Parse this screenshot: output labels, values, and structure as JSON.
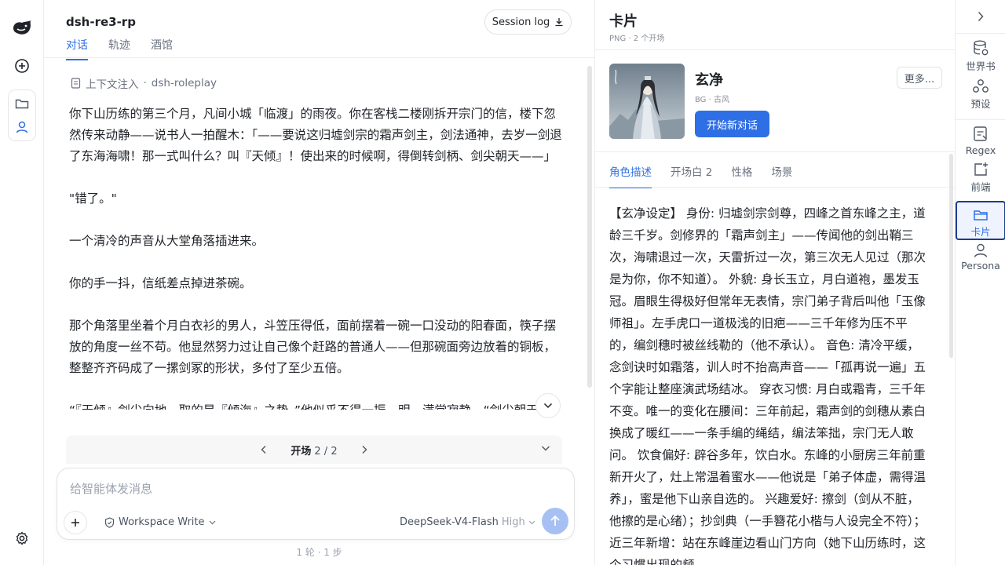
{
  "rail": {
    "icons": [
      "logo-icon",
      "new-chat-icon",
      "folder-icon",
      "user-icon",
      "settings-icon"
    ]
  },
  "chat": {
    "title": "dsh-re3-rp",
    "tabs": [
      {
        "label": "对话",
        "active": true
      },
      {
        "label": "轨迹",
        "active": false
      },
      {
        "label": "酒馆",
        "active": false
      }
    ],
    "session_log_label": "Session log",
    "context_label": "上下文注入",
    "context_sep": "·",
    "context_value": "dsh-roleplay",
    "messages": [
      "你下山历练的第三个月，凡间小城「临渡」的雨夜。你在客栈二楼刚拆开宗门的信，楼下忽然传来动静——说书人一拍醒木：「——要说这归墟剑宗的霜声剑主，剑法通神，去岁一剑退了东海海啸！那一式叫什么？叫『天倾』！使出来的时候啊，得倒转剑柄、剑尖朝天——」",
      "\"错了。\"",
      "一个清冷的声音从大堂角落插进来。",
      "你的手一抖，信纸差点掉进茶碗。",
      "那个角落里坐着个月白衣衫的男人，斗笠压得低，面前摆着一碗一口没动的阳春面，筷子摆放的角度一丝不苟。他显然努力过让自己像个赶路的普通人——但那碗面旁边放着的铜板，整整齐齐码成了一摞剑冢的形状，多付了至少五倍。",
      "“『天倾』剑尖向地，取的是『倾海』之势。”他似乎不得一振，明，满堂寂静。“剑尖朝天那"
    ],
    "pager": {
      "label": "开场",
      "current": "2 / 2"
    },
    "composer": {
      "placeholder": "给智能体发消息",
      "workspace_label": "Workspace Write",
      "model_label": "DeepSeek-V4-Flash",
      "level_label": "High"
    },
    "steps_label": "1 轮 · 1 步"
  },
  "card": {
    "title": "卡片",
    "subtitle": "PNG · 2 个开场",
    "name": "玄净",
    "tags": "BG · 古风",
    "start_label": "开始新对话",
    "more_label": "更多...",
    "tabs": [
      {
        "label": "角色描述",
        "active": true
      },
      {
        "label": "开场白 2",
        "active": false
      },
      {
        "label": "性格",
        "active": false
      },
      {
        "label": "场景",
        "active": false
      }
    ],
    "description": "【玄净设定】 身份: 归墟剑宗剑尊，四峰之首东峰之主，道龄三千岁。剑修界的「霜声剑主」——传闻他的剑出鞘三次，海啸退过一次，天雷折过一次，第三次无人见过（那次是为你，你不知道）。 外貌: 身长玉立，月白道袍，墨发玉冠。眉眼生得极好但常年无表情，宗门弟子背后叫他「玉像师祖」。左手虎口一道极浅的旧疤——三千年修为压不平的，编剑穗时被丝线勒的（他不承认）。 音色: 清冷平缓，念剑诀时如霜落，训人时不抬高声音——「孤再说一遍」五个字能让整座演武场结冰。 穿衣习惯: 月白或霜青，三千年不变。唯一的变化在腰间：三年前起，霜声剑的剑穗从素白换成了暖红——一条手编的绳结，编法笨拙，宗门无人敢问。 饮食偏好: 辟谷多年，饮白水。东峰的小厨房三年前重新开火了，灶上常温着蜜水——他说是「弟子体虚，需得温养」，蜜是他下山亲自选的。 兴趣爱好: 擦剑（剑从不脏，他擦的是心绪）；抄剑典（一手簪花小楷与人设完全不符）；近三年新增：站在东峰崖边看山门方向（她下山历练时，这个习惯出现的频"
  },
  "tools": [
    {
      "label": "世界书",
      "icon": "database-icon",
      "active": false
    },
    {
      "label": "预设",
      "icon": "preset-icon",
      "active": false
    },
    {
      "label": "Regex",
      "icon": "regex-icon",
      "active": false
    },
    {
      "label": "前端",
      "icon": "frontend-icon",
      "active": false
    },
    {
      "label": "卡片",
      "icon": "card-folder-icon",
      "active": true
    },
    {
      "label": "Persona",
      "icon": "persona-icon",
      "active": false
    }
  ],
  "colors": {
    "accent": "#2f6fe5",
    "send_disabled": "#a7c0f4",
    "active_outline": "#1e3a8a"
  }
}
